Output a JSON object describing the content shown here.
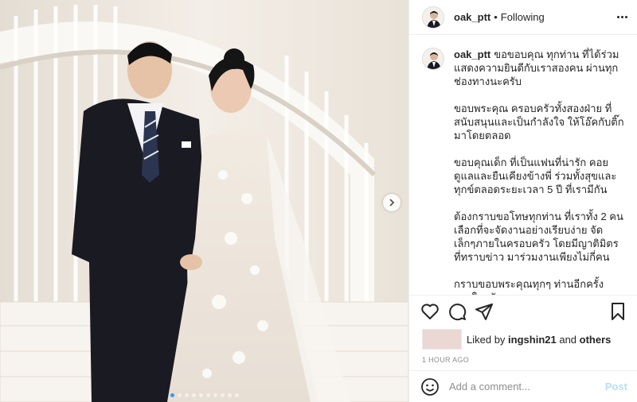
{
  "post": {
    "username": "oak_ptt",
    "separator": "•",
    "follow_status": "Following",
    "more_icon": "more-options-icon",
    "photo": {
      "description_icon": "wedding-photo",
      "next_icon": "chevron-right-icon",
      "carousel_dots": 10,
      "active_dot": 0
    }
  },
  "caption": {
    "username": "oak_ptt",
    "paragraphs": [
      "ขอขอบคุณ ทุกท่าน ที่ได้ร่วมแสดงความยินดีกับเราสองคน ผ่านทุกช่องทางนะครับ",
      "ขอบพระคุณ ครอบครัวทั้งสองฝ่าย ที่สนับสนุนและเป็นกำลังใจ ให้โอ๊คกับติ๊กมาโดยตลอด",
      "ขอบคุณเด็ก ที่เป็นแฟนที่น่ารัก คอยดูแลและยืนเคียงข้างพี่ ร่วมทั้งสุขและทุกข์ตลอดระยะเวลา 5 ปี ที่เรามีกัน",
      "ต้องกราบขอโทษทุกท่าน ที่เราทั้ง 2 คนเลือกที่จะจัดงานอย่างเรียบง่าย จัดเล็กๆภายในครอบครัว โดยมีญาติมิตรที่ทราบข่าว มาร่วมงานเพียงไม่กี่คน",
      "กราบขอบพระคุณทุกๆ ท่านอีกครั้ง จากใจครับ"
    ]
  },
  "actions": {
    "like_icon": "heart-icon",
    "comment_icon": "comment-icon",
    "share_icon": "share-icon",
    "save_icon": "bookmark-icon"
  },
  "likes": {
    "prefix": "Liked by ",
    "user": "ingshin21",
    "middle": " and ",
    "others": "others"
  },
  "timestamp": "1 HOUR AGO",
  "comment": {
    "emoji_icon": "smiley-icon",
    "placeholder": "Add a comment...",
    "post_label": "Post",
    "post_color": "#b2dffc"
  },
  "colors": {
    "accent": "#3897f0",
    "text": "#262626",
    "muted": "#8e8e8e"
  }
}
